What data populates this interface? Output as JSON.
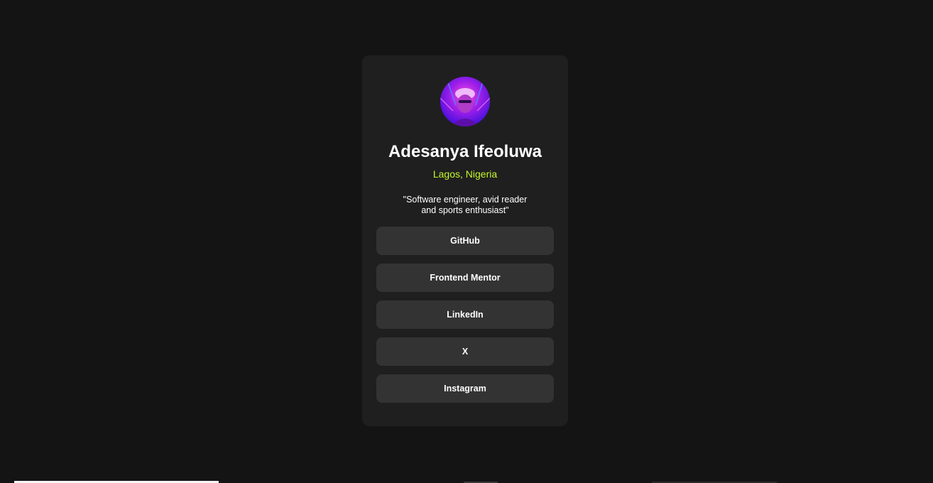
{
  "profile": {
    "name": "Adesanya Ifeoluwa",
    "location": "Lagos, Nigeria",
    "bio_line1": "\"Software engineer, avid reader",
    "bio_line2": "and sports enthusiast\""
  },
  "links": [
    {
      "label": "GitHub"
    },
    {
      "label": "Frontend Mentor"
    },
    {
      "label": "LinkedIn"
    },
    {
      "label": "X"
    },
    {
      "label": "Instagram"
    }
  ],
  "colors": {
    "background": "#141414",
    "card": "#1f1f1f",
    "button": "#333333",
    "accent": "#c4f82a",
    "text": "#ffffff"
  }
}
